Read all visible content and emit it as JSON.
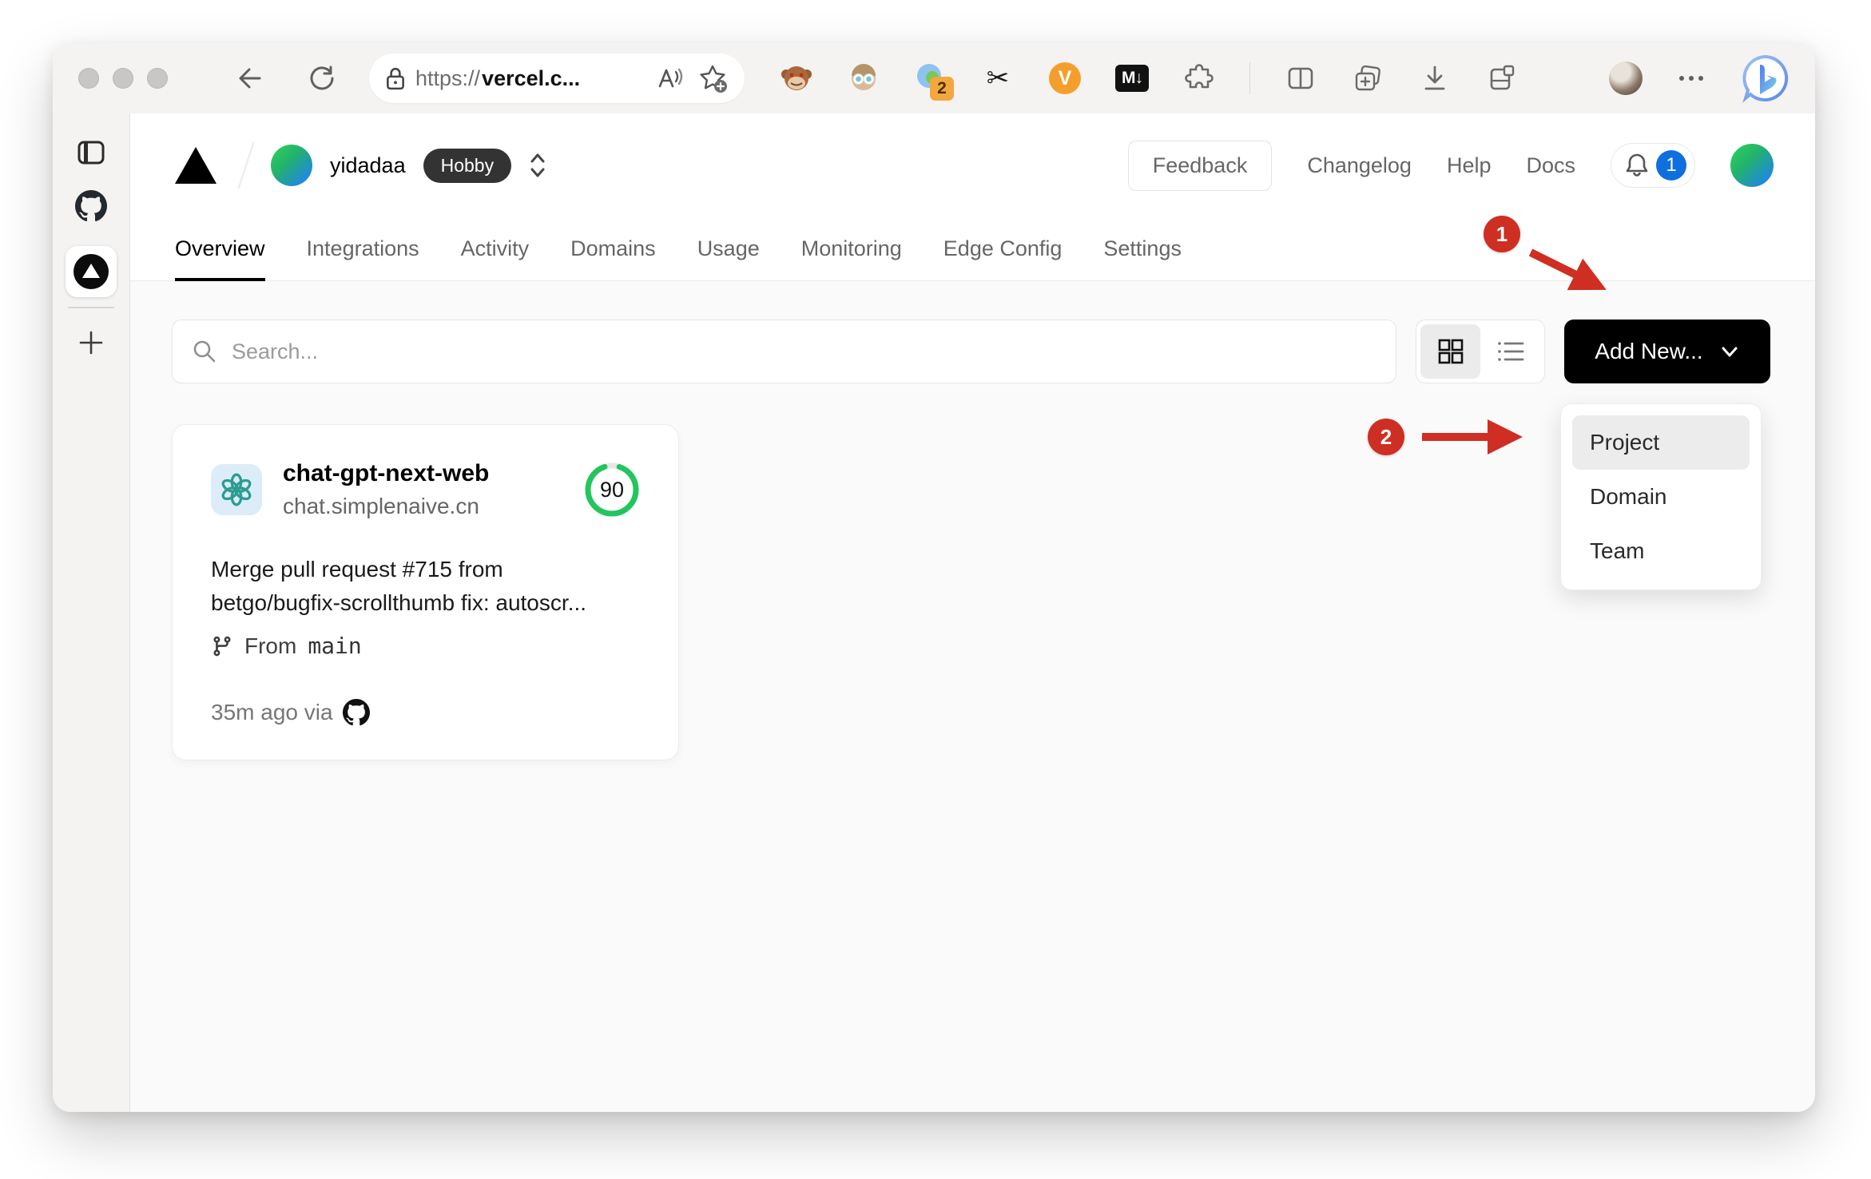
{
  "browser": {
    "url": {
      "scheme": "https://",
      "host": "vercel.c..."
    },
    "extensions": {
      "translator_badge": "2",
      "v_label": "V",
      "markdown_label": "M↓",
      "scissors_glyph": "✂"
    }
  },
  "header": {
    "team_name": "yidadaa",
    "plan_badge": "Hobby",
    "feedback_label": "Feedback",
    "links": [
      {
        "label": "Changelog"
      },
      {
        "label": "Help"
      },
      {
        "label": "Docs"
      }
    ],
    "notification_count": "1"
  },
  "tabs": [
    {
      "label": "Overview"
    },
    {
      "label": "Integrations"
    },
    {
      "label": "Activity"
    },
    {
      "label": "Domains"
    },
    {
      "label": "Usage"
    },
    {
      "label": "Monitoring"
    },
    {
      "label": "Edge Config"
    },
    {
      "label": "Settings"
    }
  ],
  "controls": {
    "search_placeholder": "Search...",
    "add_new_label": "Add New..."
  },
  "add_new_menu": {
    "items": [
      {
        "label": "Project"
      },
      {
        "label": "Domain"
      },
      {
        "label": "Team"
      }
    ]
  },
  "project_card": {
    "name": "chat-gpt-next-web",
    "domain": "chat.simplenaive.cn",
    "score": "90",
    "commit_line1": "Merge pull request #715 from",
    "commit_line2": "betgo/bugfix-scrollthumb fix: autoscr...",
    "branch_label": "From",
    "branch_name": "main",
    "deploy_meta": "35m ago via"
  },
  "annotations": {
    "step1": "1",
    "step2": "2"
  },
  "colors": {
    "annotation_red": "#cf2e23",
    "accent_green": "#22c55e",
    "notification_blue": "#0f6fde",
    "add_new_bg": "#000000",
    "page_bg": "#fafafa",
    "chrome_bg": "#f4f3f1",
    "openai_teal": "#2c9c92",
    "tile_bg": "#dcedf9"
  }
}
